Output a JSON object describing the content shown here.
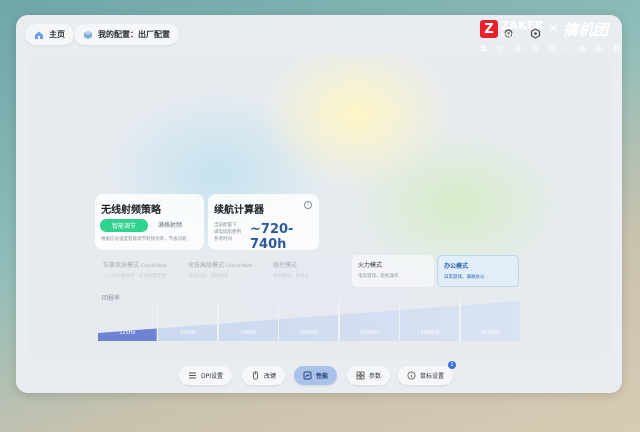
{
  "topbar": {
    "home_label": "主页",
    "config_label": "我的配置：出厂配置"
  },
  "brand": {
    "left_name": "ZAKER",
    "left_sub": "新闻",
    "separator": "×",
    "right_name": "搞机团",
    "slogan": "每 次 关 注 感 · 搞 机 有 新 意"
  },
  "wireless_card": {
    "title": "无线射频策略",
    "active_option": "智能调节",
    "other_option": "满格射频",
    "description": "根据信号强度智能调节射频功率，节省功耗"
  },
  "battery_card": {
    "title": "续航计算器",
    "info_icon": "i",
    "label_line1": "当前配置下",
    "label_line2": "满电续航使用",
    "label_line3": "参考时间",
    "value": "~720-740h"
  },
  "modes": [
    {
      "title": "狂暴竞技模式",
      "title_suffix": "Critical Mode",
      "sub": "一二天打着想玩 · 延迟低稳定性",
      "faded": true
    },
    {
      "title": "竞技高级模式",
      "title_suffix": "Critical Mode",
      "sub": "电竞对战，流畅操作",
      "faded": true
    },
    {
      "title": "稳控模式",
      "title_suffix": "",
      "sub": "长时游戏，更持久",
      "faded": true
    },
    {
      "title": "火力模式",
      "title_suffix": "",
      "sub": "电竞游戏，轻松操作",
      "faded": false
    },
    {
      "title": "办公模式",
      "title_suffix": "",
      "sub": "日常游戏，兼顾办公",
      "faded": false,
      "active": true
    }
  ],
  "report_rate": {
    "label": "回报率",
    "options": [
      "125Hz",
      "250Hz",
      "500Hz",
      "1000Hz",
      "2000Hz",
      "4000Hz",
      "8000Hz"
    ],
    "selected_index": 0
  },
  "bottom_nav": {
    "items": [
      {
        "label": "DPI设置",
        "icon": "list-icon"
      },
      {
        "label": "改键",
        "icon": "mouse-icon"
      },
      {
        "label": "性能",
        "icon": "performance-icon",
        "active": true
      },
      {
        "label": "参数",
        "icon": "grid-icon"
      },
      {
        "label": "鼠标设置",
        "icon": "info-icon",
        "badge": "2"
      }
    ]
  },
  "colors": {
    "accent_green": "#2fd38e",
    "accent_blue": "#2c62b0",
    "nav_active": "#aac2ea",
    "brand_red": "#e8212a"
  }
}
